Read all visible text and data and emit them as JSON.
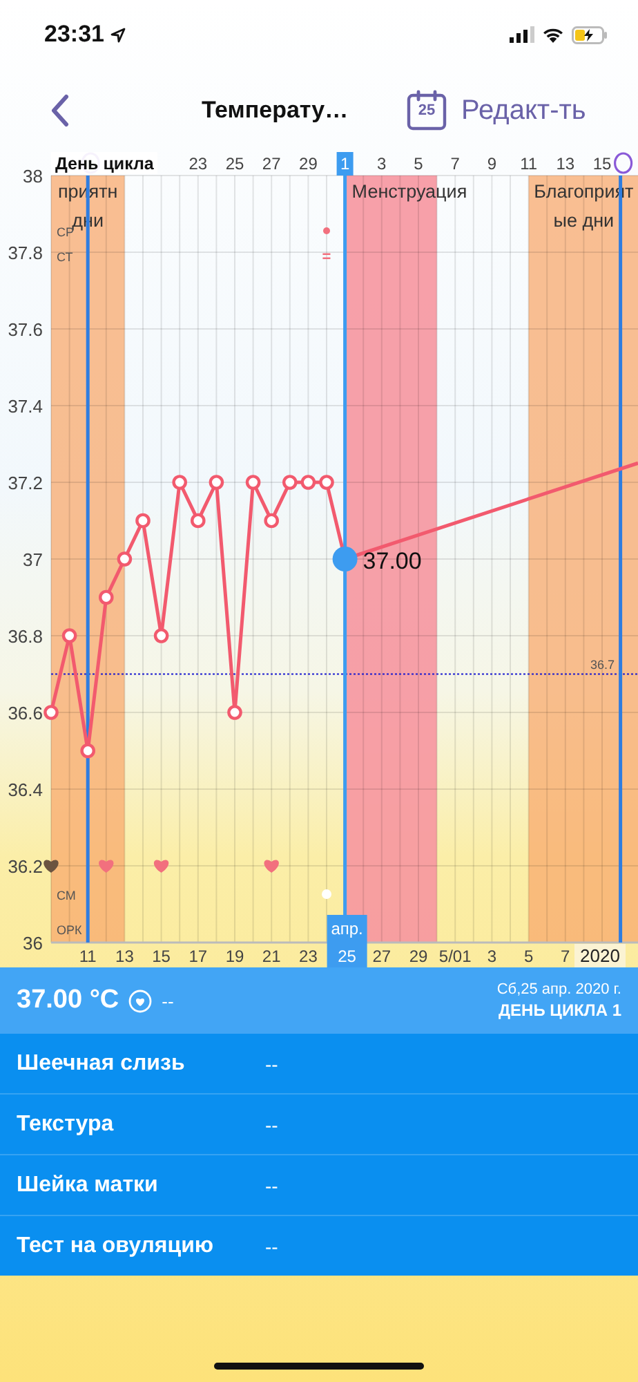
{
  "status_bar": {
    "time": "23:31"
  },
  "nav": {
    "title": "Температу…",
    "calendar_day": "25",
    "edit": "Редакт-ть"
  },
  "chart": {
    "x_title": "День цикла",
    "row_labels": [
      "СР",
      "СТ",
      "СМ",
      "ОРК"
    ],
    "month_label": "апр.",
    "year_label": "2020",
    "selected_label": "37.00",
    "zones": [
      {
        "label": [
          "приятн",
          "дни"
        ]
      },
      {
        "label": [
          "Менструация"
        ]
      },
      {
        "label": [
          "Благоприят",
          "ые дни"
        ]
      }
    ],
    "days": [
      {
        "kind": "fertile",
        "color": "#6b5340"
      },
      {
        "kind": "fertile"
      },
      {
        "kind": "ovulation"
      },
      {
        "kind": "fertile",
        "color": "#f2707e"
      },
      {
        "kind": "plain"
      },
      {
        "kind": "plain"
      },
      {
        "kind": "plain",
        "color": "#f2707e"
      },
      {
        "kind": "plain"
      },
      {
        "kind": "plain",
        "cycle_label": "23"
      },
      {
        "kind": "plain"
      },
      {
        "kind": "plain",
        "cycle_label": "25"
      },
      {
        "kind": "plain"
      },
      {
        "kind": "plain",
        "color": "#f2707e",
        "cycle_label": "27"
      },
      {
        "kind": "plain"
      },
      {
        "kind": "plain",
        "cycle_label": "29"
      },
      {
        "kind": "plain",
        "marks": [
          {
            "kind": "cp_dot",
            "color": "#f2707e"
          },
          {
            "kind": "ct_text",
            "label": "="
          },
          {
            "kind": "cm_dot",
            "color": "#ffffff"
          }
        ]
      },
      {
        "kind": "period",
        "cycle_label": "1"
      },
      {
        "kind": "period"
      },
      {
        "kind": "period",
        "cycle_label": "3"
      },
      {
        "kind": "period"
      },
      {
        "kind": "period",
        "cycle_label": "5"
      },
      {
        "kind": "plain"
      },
      {
        "kind": "plain",
        "cycle_label": "7"
      },
      {
        "kind": "plain"
      },
      {
        "kind": "plain",
        "cycle_label": "9"
      },
      {
        "kind": "plain"
      },
      {
        "kind": "fertile",
        "cycle_label": "11"
      },
      {
        "kind": "fertile"
      },
      {
        "kind": "fertile",
        "cycle_label": "13"
      },
      {
        "kind": "fertile"
      },
      {
        "kind": "fertile",
        "cycle_label": "15"
      },
      {
        "kind": "ovulation"
      }
    ],
    "chart_data": {
      "type": "line",
      "grid": true,
      "categories": [
        null,
        null,
        "11",
        null,
        "13",
        null,
        "15",
        null,
        "17",
        null,
        "19",
        null,
        "21",
        null,
        "23",
        null,
        "25",
        null,
        "27",
        null,
        "29",
        null,
        "5/01",
        null,
        "3",
        null,
        "5",
        null,
        "7",
        null,
        null,
        null
      ],
      "series": [
        {
          "color": "#f25a6e",
          "marker": "circle",
          "values": [
            36.6,
            36.8,
            36.5,
            36.9,
            37.0,
            37.1,
            36.8,
            37.2,
            37.1,
            37.2,
            36.6,
            37.2,
            37.1,
            37.2,
            37.2,
            37.2,
            37.0,
            null,
            null,
            null,
            null,
            null,
            null,
            null,
            null,
            null,
            null,
            null,
            null,
            null,
            null,
            null
          ]
        }
      ],
      "ylim": [
        36,
        38
      ],
      "yticks": [
        38,
        37.8,
        37.6,
        37.4,
        37.2,
        37,
        36.8,
        36.6,
        36.4,
        36.2,
        36
      ],
      "ref_lines": [
        {
          "axis": "y",
          "value": 36.7,
          "label": "36.7"
        }
      ]
    }
  },
  "summary": {
    "temperature": "37.00 °C",
    "note": "--",
    "date": "Сб,25 апр. 2020 г.",
    "cycle_day": "ДЕНЬ ЦИКЛА 1"
  },
  "details": [
    {
      "label": "Шеечная слизь",
      "value": "--"
    },
    {
      "label": "Текстура",
      "value": "--"
    },
    {
      "label": "Шейка матки",
      "value": "--"
    },
    {
      "label": "Тест на овуляцию",
      "value": "--"
    }
  ]
}
